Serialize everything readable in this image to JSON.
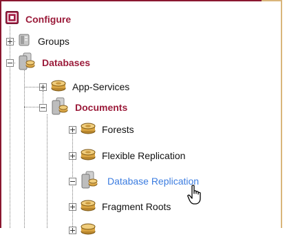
{
  "tree": {
    "root": {
      "label": "Configure",
      "icon": "configure-icon"
    },
    "items": [
      {
        "label": "Groups",
        "icon": "server-group-icon",
        "expander": "plus"
      },
      {
        "label": "Databases",
        "icon": "database-stack-icon",
        "expander": "minus"
      },
      {
        "label": "App-Services",
        "icon": "database-disk-icon",
        "expander": "plus"
      },
      {
        "label": "Documents",
        "icon": "database-stack-icon",
        "expander": "minus"
      },
      {
        "label": "Forests",
        "icon": "database-disk-icon",
        "expander": "plus"
      },
      {
        "label": "Flexible Replication",
        "icon": "database-disk-icon",
        "expander": "plus"
      },
      {
        "label": "Database Replication",
        "icon": "database-stack-icon",
        "expander": "minus"
      },
      {
        "label": "Fragment Roots",
        "icon": "database-disk-icon",
        "expander": "plus"
      }
    ]
  },
  "colors": {
    "frame": "#8a1730",
    "bold_label": "#9b1b3a",
    "hover_link": "#3b7ce0"
  },
  "cursor": {
    "icon": "hand-pointer-icon"
  }
}
